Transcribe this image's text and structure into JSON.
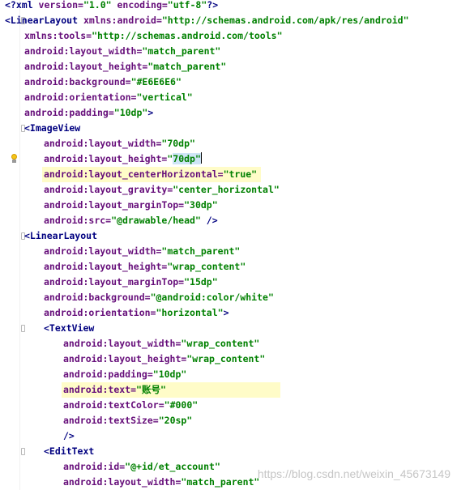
{
  "editor": {
    "lines": [
      {
        "indent": 0,
        "fold": false,
        "hl": false,
        "tokens": [
          {
            "t": "<?xml ",
            "c": "tag"
          },
          {
            "t": "version=",
            "c": "attr"
          },
          {
            "t": "\"1.0\" ",
            "c": "val"
          },
          {
            "t": "encoding=",
            "c": "attr"
          },
          {
            "t": "\"utf-8\"",
            "c": "val"
          },
          {
            "t": "?>",
            "c": "tag"
          }
        ]
      },
      {
        "indent": 0,
        "fold": true,
        "hl": false,
        "tokens": [
          {
            "t": "<LinearLayout ",
            "c": "tag"
          },
          {
            "t": "xmlns:android=",
            "c": "attr"
          },
          {
            "t": "\"http://schemas.android.com/apk/res/android\"",
            "c": "val"
          }
        ]
      },
      {
        "indent": 1,
        "fold": false,
        "hl": false,
        "tokens": [
          {
            "t": "xmlns:tools=",
            "c": "attr"
          },
          {
            "t": "\"http://schemas.android.com/tools\"",
            "c": "val"
          }
        ]
      },
      {
        "indent": 1,
        "fold": false,
        "hl": false,
        "tokens": [
          {
            "t": "android",
            "c": "ns"
          },
          {
            "t": ":layout_width=",
            "c": "attr"
          },
          {
            "t": "\"match_parent\"",
            "c": "val"
          }
        ]
      },
      {
        "indent": 1,
        "fold": false,
        "hl": false,
        "tokens": [
          {
            "t": "android",
            "c": "ns"
          },
          {
            "t": ":layout_height=",
            "c": "attr"
          },
          {
            "t": "\"match_parent\"",
            "c": "val"
          }
        ]
      },
      {
        "indent": 1,
        "fold": false,
        "hl": false,
        "tokens": [
          {
            "t": "android",
            "c": "ns"
          },
          {
            "t": ":background=",
            "c": "attr"
          },
          {
            "t": "\"#E6E6E6\"",
            "c": "val"
          }
        ]
      },
      {
        "indent": 1,
        "fold": false,
        "hl": false,
        "tokens": [
          {
            "t": "android",
            "c": "ns"
          },
          {
            "t": ":orientation=",
            "c": "attr"
          },
          {
            "t": "\"vertical\"",
            "c": "val"
          }
        ]
      },
      {
        "indent": 1,
        "fold": false,
        "hl": false,
        "tokens": [
          {
            "t": "android",
            "c": "ns"
          },
          {
            "t": ":padding=",
            "c": "attr"
          },
          {
            "t": "\"10dp\"",
            "c": "val"
          },
          {
            "t": ">",
            "c": "tag"
          }
        ]
      },
      {
        "indent": 1,
        "fold": true,
        "hl": false,
        "tokens": [
          {
            "t": "<ImageView",
            "c": "tag"
          }
        ]
      },
      {
        "indent": 2,
        "fold": false,
        "hl": false,
        "tokens": [
          {
            "t": "android",
            "c": "ns"
          },
          {
            "t": ":layout_width=",
            "c": "attr"
          },
          {
            "t": "\"70dp\"",
            "c": "val"
          }
        ]
      },
      {
        "indent": 2,
        "fold": false,
        "hl": false,
        "bulb": true,
        "tokens": [
          {
            "t": "android",
            "c": "ns"
          },
          {
            "t": ":layout_height=",
            "c": "attr"
          },
          {
            "t": "\"",
            "c": "val"
          },
          {
            "t": "70dp",
            "c": "val sel"
          },
          {
            "t": "\"",
            "c": "val sel"
          },
          {
            "caret": true
          }
        ]
      },
      {
        "indent": 2,
        "fold": false,
        "hl": true,
        "tokens": [
          {
            "t": "android",
            "c": "ns"
          },
          {
            "t": ":layout_centerHorizontal=",
            "c": "attr"
          },
          {
            "t": "\"true\"",
            "c": "val"
          }
        ]
      },
      {
        "indent": 2,
        "fold": false,
        "hl": false,
        "tokens": [
          {
            "t": "android",
            "c": "ns"
          },
          {
            "t": ":layout_gravity=",
            "c": "attr"
          },
          {
            "t": "\"center_horizontal\"",
            "c": "val"
          }
        ]
      },
      {
        "indent": 2,
        "fold": false,
        "hl": false,
        "tokens": [
          {
            "t": "android",
            "c": "ns"
          },
          {
            "t": ":layout_marginTop=",
            "c": "attr"
          },
          {
            "t": "\"30dp\"",
            "c": "val"
          }
        ]
      },
      {
        "indent": 2,
        "fold": false,
        "hl": false,
        "tokens": [
          {
            "t": "android",
            "c": "ns"
          },
          {
            "t": ":src=",
            "c": "attr"
          },
          {
            "t": "\"@drawable/head\" ",
            "c": "val"
          },
          {
            "t": "/>",
            "c": "tag"
          }
        ]
      },
      {
        "indent": 1,
        "fold": true,
        "hl": false,
        "tokens": [
          {
            "t": "<LinearLayout",
            "c": "tag"
          }
        ]
      },
      {
        "indent": 2,
        "fold": false,
        "hl": false,
        "tokens": [
          {
            "t": "android",
            "c": "ns"
          },
          {
            "t": ":layout_width=",
            "c": "attr"
          },
          {
            "t": "\"match_parent\"",
            "c": "val"
          }
        ]
      },
      {
        "indent": 2,
        "fold": false,
        "hl": false,
        "tokens": [
          {
            "t": "android",
            "c": "ns"
          },
          {
            "t": ":layout_height=",
            "c": "attr"
          },
          {
            "t": "\"wrap_content\"",
            "c": "val"
          }
        ]
      },
      {
        "indent": 2,
        "fold": false,
        "hl": false,
        "tokens": [
          {
            "t": "android",
            "c": "ns"
          },
          {
            "t": ":layout_marginTop=",
            "c": "attr"
          },
          {
            "t": "\"15dp\"",
            "c": "val"
          }
        ]
      },
      {
        "indent": 2,
        "fold": false,
        "hl": false,
        "tokens": [
          {
            "t": "android",
            "c": "ns"
          },
          {
            "t": ":background=",
            "c": "attr"
          },
          {
            "t": "\"@android:color/white\"",
            "c": "val"
          }
        ]
      },
      {
        "indent": 2,
        "fold": false,
        "hl": false,
        "tokens": [
          {
            "t": "android",
            "c": "ns"
          },
          {
            "t": ":orientation=",
            "c": "attr"
          },
          {
            "t": "\"horizontal\"",
            "c": "val"
          },
          {
            "t": ">",
            "c": "tag"
          }
        ]
      },
      {
        "indent": 2,
        "fold": true,
        "hl": false,
        "tokens": [
          {
            "t": "<TextView",
            "c": "tag"
          }
        ]
      },
      {
        "indent": 3,
        "fold": false,
        "hl": false,
        "tokens": [
          {
            "t": "android",
            "c": "ns"
          },
          {
            "t": ":layout_width=",
            "c": "attr"
          },
          {
            "t": "\"wrap_content\"",
            "c": "val"
          }
        ]
      },
      {
        "indent": 3,
        "fold": false,
        "hl": false,
        "tokens": [
          {
            "t": "android",
            "c": "ns"
          },
          {
            "t": ":layout_height=",
            "c": "attr"
          },
          {
            "t": "\"wrap_content\"",
            "c": "val"
          }
        ]
      },
      {
        "indent": 3,
        "fold": false,
        "hl": false,
        "tokens": [
          {
            "t": "android",
            "c": "ns"
          },
          {
            "t": ":padding=",
            "c": "attr"
          },
          {
            "t": "\"10dp\"",
            "c": "val"
          }
        ]
      },
      {
        "indent": 3,
        "fold": false,
        "hl": true,
        "tokens": [
          {
            "t": "android",
            "c": "ns"
          },
          {
            "t": ":text=",
            "c": "attr"
          },
          {
            "t": "\"账号\"",
            "c": "val"
          }
        ]
      },
      {
        "indent": 3,
        "fold": false,
        "hl": false,
        "tokens": [
          {
            "t": "android",
            "c": "ns"
          },
          {
            "t": ":textColor=",
            "c": "attr"
          },
          {
            "t": "\"#000\"",
            "c": "val"
          }
        ]
      },
      {
        "indent": 3,
        "fold": false,
        "hl": false,
        "tokens": [
          {
            "t": "android",
            "c": "ns"
          },
          {
            "t": ":textSize=",
            "c": "attr"
          },
          {
            "t": "\"20sp\"",
            "c": "val"
          }
        ]
      },
      {
        "indent": 3,
        "fold": false,
        "hl": false,
        "tokens": [
          {
            "t": "/>",
            "c": "tag"
          }
        ]
      },
      {
        "indent": 2,
        "fold": true,
        "hl": false,
        "tokens": [
          {
            "t": "<EditText",
            "c": "tag"
          }
        ]
      },
      {
        "indent": 3,
        "fold": false,
        "hl": false,
        "tokens": [
          {
            "t": "android",
            "c": "ns"
          },
          {
            "t": ":id=",
            "c": "attr"
          },
          {
            "t": "\"@+id/et_account\"",
            "c": "val"
          }
        ]
      },
      {
        "indent": 3,
        "fold": false,
        "hl": false,
        "tokens": [
          {
            "t": "android",
            "c": "ns"
          },
          {
            "t": ":layout_width=",
            "c": "attr"
          },
          {
            "t": "\"match_parent\"",
            "c": "val"
          }
        ]
      }
    ]
  },
  "watermark": "https://blog.csdn.net/weixin_45673149"
}
